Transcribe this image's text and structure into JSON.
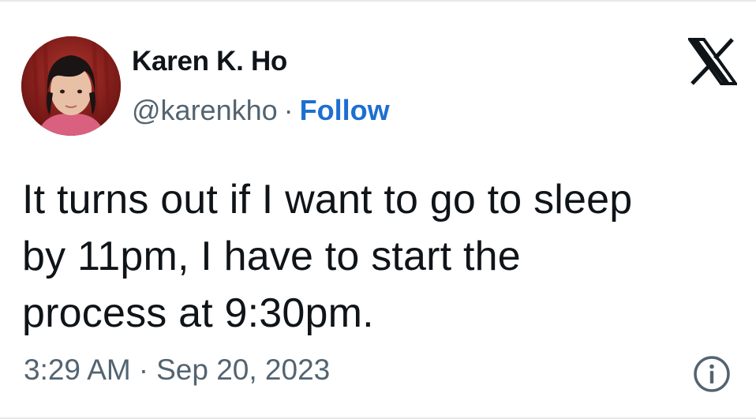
{
  "author": {
    "display_name": "Karen K. Ho",
    "handle": "@karenkho",
    "separator": "·",
    "follow_label": "Follow"
  },
  "tweet": {
    "lines": [
      "It turns out if I want to go to sleep",
      "by 11pm, I have to start the",
      "process at 9:30pm."
    ]
  },
  "meta": {
    "time": "3:29 AM",
    "separator": "·",
    "date": "Sep 20, 2023"
  },
  "icons": {
    "brand": "x-logo-icon",
    "info": "info-icon",
    "avatar": "avatar"
  },
  "colors": {
    "text": "#0f1419",
    "secondary": "#536471",
    "link": "#1d6fd1"
  }
}
